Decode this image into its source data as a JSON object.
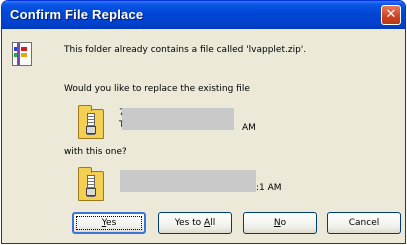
{
  "window": {
    "title": "Confirm File Replace",
    "close_glyph": "✕"
  },
  "message": {
    "intro": "This folder already contains a file called 'lvapplet.zip'.",
    "question": "Would you like to replace the existing file",
    "existing_line1": "7",
    "existing_line2": "T",
    "existing_suffix": "AM",
    "with_label": "with this one?",
    "new_suffix": ":1 AM"
  },
  "buttons": {
    "yes": {
      "mnemonic": "Y",
      "rest": "es"
    },
    "yes_to_all": {
      "before": "Yes to ",
      "mnemonic": "A",
      "after": "ll"
    },
    "no": {
      "mnemonic": "N",
      "rest": "o"
    },
    "cancel": "Cancel"
  },
  "icons": {
    "close": "close-icon",
    "zip_file": "zip-file-icon",
    "zip_folder": "zip-folder-icon"
  },
  "colors": {
    "title_bar": "#0046d5",
    "close_button": "#cc4320",
    "dialog_bg": "#ece9d8",
    "redaction": "#c9c9c9"
  }
}
